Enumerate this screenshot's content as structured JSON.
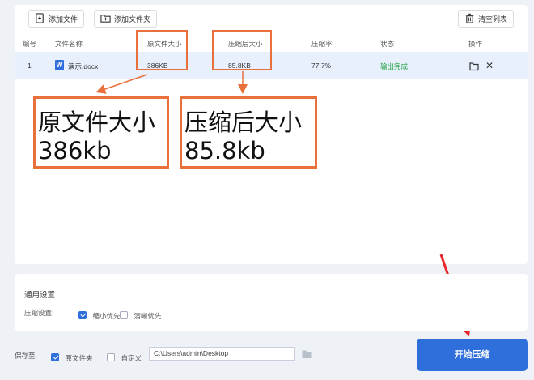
{
  "toolbar": {
    "add_file": "添加文件",
    "add_folder": "添加文件夹",
    "clear_list": "清空列表"
  },
  "columns": [
    "编号",
    "文件名称",
    "原文件大小",
    "压缩后大小",
    "压缩率",
    "状态",
    "操作"
  ],
  "rows": [
    {
      "index": "1",
      "filename": "演示.docx",
      "orig_size": "386KB",
      "comp_size": "85.8KB",
      "ratio": "77.7%",
      "status": "输出完成"
    }
  ],
  "annotation": {
    "orig_title": "原文件大小",
    "orig_value": "386kb",
    "comp_title": "压缩后大小",
    "comp_value": "85.8kb"
  },
  "settings": {
    "title": "通用设置",
    "compress_label": "压缩设置:",
    "option_small": "缩小优先",
    "option_small_checked": true,
    "option_clear": "清晰优先",
    "option_clear_checked": false
  },
  "save": {
    "label": "保存至:",
    "option_source": "原文件夹",
    "option_source_checked": true,
    "option_custom": "自定义",
    "option_custom_checked": false,
    "path": "C:\\Users\\admin\\Desktop"
  },
  "start_button": "开始压缩",
  "colors": {
    "accent": "#2f6fdc",
    "highlight": "#e8703a",
    "arrow": "#e8262a",
    "status_done": "#1a9e3a"
  }
}
